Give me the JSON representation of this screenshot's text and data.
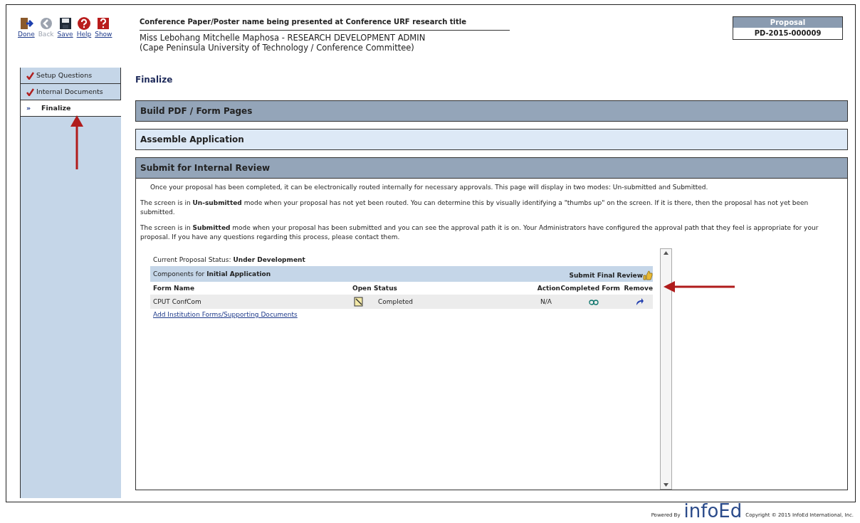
{
  "toolbar": [
    {
      "label": "Done",
      "kind": "done",
      "disabled": false
    },
    {
      "label": "Back",
      "kind": "back",
      "disabled": true
    },
    {
      "label": "Save",
      "kind": "save",
      "disabled": false
    },
    {
      "label": "Help",
      "kind": "help",
      "disabled": false
    },
    {
      "label": "Show",
      "kind": "show",
      "disabled": false
    }
  ],
  "header": {
    "title": "Conference Paper/Poster name being presented at Conference URF research title",
    "person": "Miss Lebohang Mitchelle Maphosa - RESEARCH DEVELOPMENT ADMIN",
    "organization": "(Cape Peninsula University of Technology / Conference Committee)"
  },
  "proposal": {
    "label": "Proposal",
    "number": "PD-2015-000009"
  },
  "sidebar": {
    "items": [
      {
        "label": "Setup Questions",
        "completed": true,
        "selected": false
      },
      {
        "label": "Internal Documents",
        "completed": true,
        "selected": false
      },
      {
        "label": "Finalize",
        "completed": false,
        "selected": true,
        "marker": "»"
      }
    ]
  },
  "page_title": "Finalize",
  "sections": [
    {
      "title": "Build PDF / Form Pages",
      "color": "#94a5b9"
    },
    {
      "title": "Assemble Application",
      "color": "#dde9f6"
    },
    {
      "title": "Submit for Internal Review",
      "color": "#94a5b9"
    }
  ],
  "paragraphs": [
    "Once your proposal has been completed, it can be electronically routed internally for necessary approvals. This page will display in two modes: Un-submitted and Submitted.",
    "The screen is in **Un-submitted** mode when your proposal has not yet been routed. You can determine this by visually identifying a \"thumbs up\" on the screen. If it is there, then the proposal has not yet been submitted.",
    "The screen is in **Submitted** mode when your proposal has been submitted and you can see the approval path it is on. Your Administrators have configured the approval path that they feel is appropriate for your proposal. If you have any questions regarding this process, please contact them."
  ],
  "status": {
    "label": "Current Proposal Status:",
    "value": "Under Development"
  },
  "components": {
    "label": "Components for",
    "value": "Initial Application",
    "submit": "Submit Final Review"
  },
  "table": {
    "columns": [
      "Form Name",
      "Open",
      "Status",
      "Action",
      "Completed Form",
      "Remove"
    ],
    "rows": [
      {
        "form_name": "CPUT ConfCom",
        "status": "Completed",
        "action": "N/A"
      }
    ]
  },
  "add_link": "Add Institution Forms/Supporting Documents",
  "footer": {
    "powered": "Powered By",
    "brand": "infoEd",
    "copyright": "Copyright © 2015 InfoEd International, Inc."
  }
}
